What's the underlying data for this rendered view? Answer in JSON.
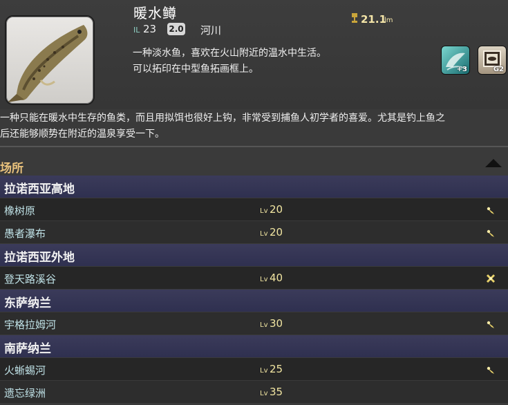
{
  "fish": {
    "name": "暖水鳟",
    "il_label": "IL",
    "il_value": "23",
    "patch": "2.0",
    "water_type": "河川",
    "size_value": "21.1",
    "size_unit": "lm",
    "desc_line1": "一种淡水鱼，喜欢在火山附近的温水中生活。",
    "desc_line2": "可以拓印在中型鱼拓画框上。",
    "badges": [
      {
        "label": "+3",
        "icon": "fish-jump-icon"
      },
      {
        "label": "G2",
        "icon": "aquarium-frame-icon"
      }
    ]
  },
  "long_description": [
    "一种只能在暖水中生存的鱼类，而且用拟饵也很好上钩，非常受到捕鱼人初学者的喜爱。尤其是钓上鱼之",
    "后还能够顺势在附近的温泉享受一下。"
  ],
  "section_title": "场所",
  "regions": [
    {
      "name": "拉诺西亚高地",
      "spots": [
        {
          "name": "橡树原",
          "lv_prefix": "Lv",
          "level": "20",
          "icon": "pin-icon"
        },
        {
          "name": "愚者瀑布",
          "lv_prefix": "Lv",
          "level": "20",
          "icon": "pin-icon"
        }
      ]
    },
    {
      "name": "拉诺西亚外地",
      "spots": [
        {
          "name": "登天路溪谷",
          "lv_prefix": "Lv",
          "level": "40",
          "icon": "cross-pin-icon"
        }
      ]
    },
    {
      "name": "东萨纳兰",
      "spots": [
        {
          "name": "宇格拉姆河",
          "lv_prefix": "Lv",
          "level": "30",
          "icon": "pin-icon"
        }
      ]
    },
    {
      "name": "南萨纳兰",
      "spots": [
        {
          "name": "火蜥蜴河",
          "lv_prefix": "Lv",
          "level": "25",
          "icon": "pin-icon"
        },
        {
          "name": "遗忘绿洲",
          "lv_prefix": "Lv",
          "level": "35",
          "icon": ""
        }
      ]
    }
  ]
}
